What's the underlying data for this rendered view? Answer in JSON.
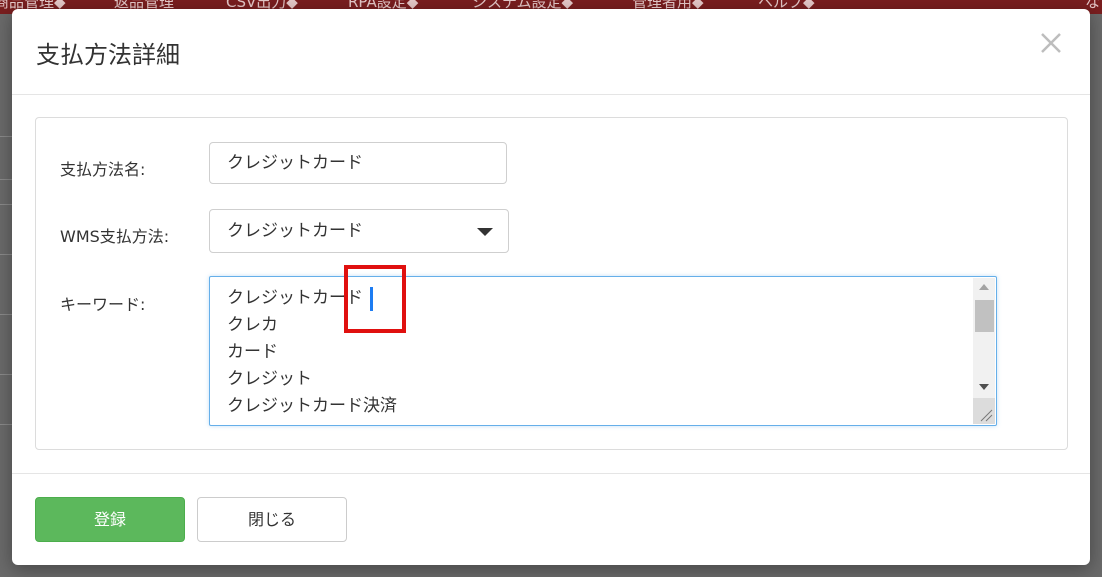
{
  "background_nav": {
    "items": [
      "商品管理◆",
      "返品管理",
      "CSV出力◆",
      "RPA設定◆",
      "システム設定◆",
      "管理者用◆",
      "ヘルプ◆",
      "な"
    ]
  },
  "modal": {
    "title": "支払方法詳細",
    "close_icon": "close-icon",
    "fields": {
      "payment_name_label": "支払方法名:",
      "payment_name_value": "クレジットカード",
      "wms_label": "WMS支払方法:",
      "wms_selected": "クレジットカード",
      "keyword_label": "キーワード:",
      "keywords": [
        "クレジットカード",
        "クレカ",
        "カード",
        "クレジット",
        "クレジットカード決済"
      ]
    },
    "buttons": {
      "register": "登録",
      "close": "閉じる"
    }
  },
  "colors": {
    "nav_bg": "#7a1e1f",
    "primary_button": "#5cb85c",
    "focus_border": "#66afe9",
    "caret": "#1d7cf2",
    "highlight": "#e0100f"
  }
}
